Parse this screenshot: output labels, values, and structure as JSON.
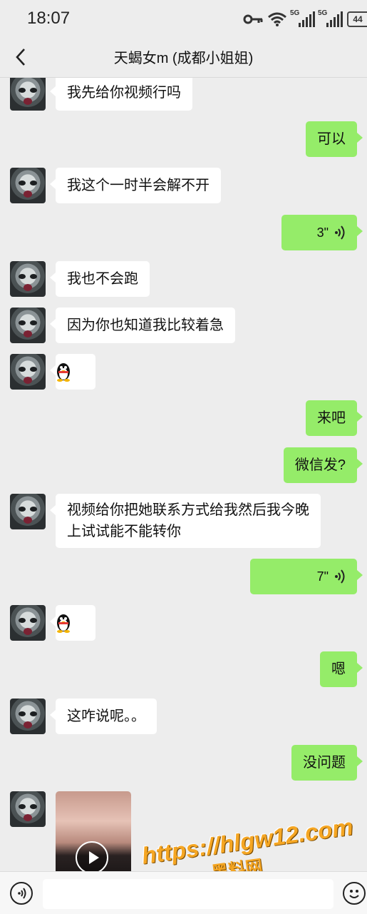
{
  "status_bar": {
    "time": "18:07",
    "icons": [
      "key-icon",
      "wifi-icon",
      "signal-5g-icon",
      "signal-5g-icon",
      "battery-icon"
    ],
    "signal_tag": "5G",
    "battery": "44"
  },
  "header": {
    "back_icon": "chevron-left-icon",
    "title": "天蝎女m (成都小姐姐)"
  },
  "messages": [
    {
      "side": "in",
      "type": "text",
      "text": "我先给你视频行吗"
    },
    {
      "side": "out",
      "type": "text",
      "text": "可以"
    },
    {
      "side": "in",
      "type": "text",
      "text": "我这个一时半会解不开"
    },
    {
      "side": "out",
      "type": "voice",
      "text": "3\""
    },
    {
      "side": "in",
      "type": "text",
      "text": "我也不会跑"
    },
    {
      "side": "in",
      "type": "text",
      "text": "因为你也知道我比较着急"
    },
    {
      "side": "in",
      "type": "emoji",
      "icon": "qq-penguin-icon"
    },
    {
      "side": "out",
      "type": "text",
      "text": "来吧"
    },
    {
      "side": "out",
      "type": "text",
      "text": "微信发?"
    },
    {
      "side": "in",
      "type": "text",
      "text": "视频给你把她联系方式给我然后我今晚",
      "text2": "上试试能不能转你"
    },
    {
      "side": "out",
      "type": "voice",
      "text": "7\""
    },
    {
      "side": "in",
      "type": "emoji",
      "icon": "qq-penguin-icon"
    },
    {
      "side": "out",
      "type": "text",
      "text": "嗯"
    },
    {
      "side": "in",
      "type": "text",
      "text": "这咋说呢。。"
    },
    {
      "side": "out",
      "type": "text",
      "text": "没问题"
    },
    {
      "side": "in",
      "type": "video",
      "icon": "play-icon"
    }
  ],
  "watermark": {
    "url": "https://hlgw12.com",
    "name": "黑料网"
  },
  "input_bar": {
    "left_icon": "voice-input-icon",
    "right_icon": "emoji-icon",
    "value": ""
  },
  "colors": {
    "background": "#ededed",
    "outgoing_bubble": "#95ec69",
    "incoming_bubble": "#ffffff",
    "watermark": "#f5a623"
  }
}
